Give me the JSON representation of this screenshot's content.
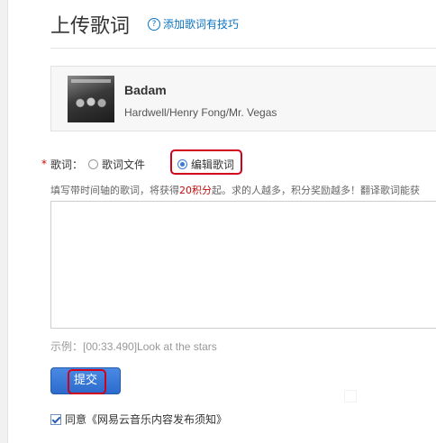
{
  "page": {
    "title": "上传歌词",
    "tips_link": "添加歌词有技巧"
  },
  "song": {
    "name": "Badam",
    "artists": "Hardwell/Henry Fong/Mr. Vegas"
  },
  "lyrics": {
    "label": "歌词：",
    "options": [
      {
        "label": "歌词文件",
        "checked": false
      },
      {
        "label": "编辑歌词",
        "checked": true
      }
    ],
    "hint_before": "填写带时间轴的歌词，将获得",
    "hint_reward": "20积分",
    "hint_after": "起。求的人越多，积分奖励越多！翻译歌词能获",
    "textarea_value": "",
    "example": "示例：[00:33.490]Look at the stars"
  },
  "actions": {
    "submit": "提交"
  },
  "agreement": {
    "checked": true,
    "text": "同意《网易云音乐内容发布须知》"
  },
  "colors": {
    "accent_link": "#0c73c2",
    "reward_red": "#c20c0c",
    "button_blue": "#2c6bcc",
    "highlight_red": "#d0021b"
  }
}
